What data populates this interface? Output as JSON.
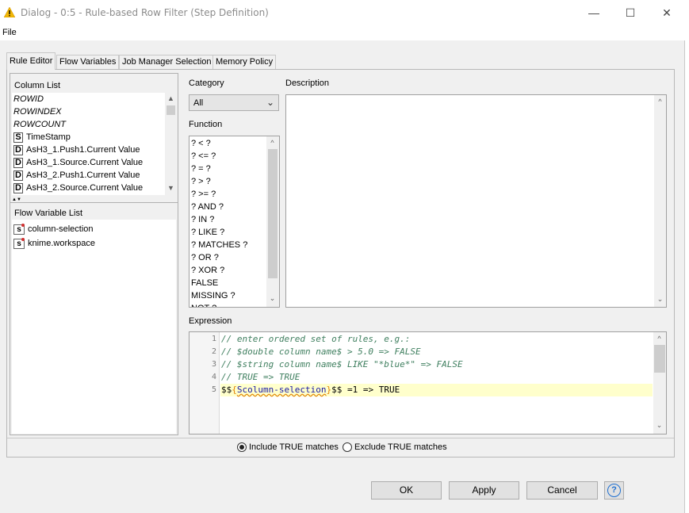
{
  "window": {
    "title": "Dialog - 0:5 - Rule-based Row Filter (Step Definition)",
    "minimize": "—",
    "maximize": "☐",
    "close": "✕"
  },
  "menu": {
    "file": "File"
  },
  "tabs": [
    {
      "label": "Rule Editor",
      "active": true
    },
    {
      "label": "Flow Variables"
    },
    {
      "label": "Job Manager Selection"
    },
    {
      "label": "Memory Policy"
    }
  ],
  "column_list": {
    "title": "Column List",
    "items": [
      {
        "label": "ROWID",
        "type": ""
      },
      {
        "label": "ROWINDEX",
        "type": ""
      },
      {
        "label": "ROWCOUNT",
        "type": ""
      },
      {
        "label": "TimeStamp",
        "type": "S"
      },
      {
        "label": "AsH3_1.Push1.Current Value",
        "type": "D"
      },
      {
        "label": "AsH3_1.Source.Current Value",
        "type": "D"
      },
      {
        "label": "AsH3_2.Push1.Current Value",
        "type": "D"
      },
      {
        "label": "AsH3_2.Source.Current Value",
        "type": "D"
      }
    ]
  },
  "flow_variable_list": {
    "title": "Flow Variable List",
    "items": [
      {
        "label": "column-selection",
        "type": "s"
      },
      {
        "label": "knime.workspace",
        "type": "s"
      }
    ]
  },
  "category": {
    "label": "Category",
    "value": "All"
  },
  "function": {
    "label": "Function",
    "items": [
      "? < ?",
      "? <= ?",
      "? = ?",
      "? > ?",
      "? >= ?",
      "? AND ?",
      "? IN ?",
      "? LIKE ?",
      "? MATCHES ?",
      "? OR ?",
      "? XOR ?",
      "FALSE",
      "MISSING ?",
      "NOT ?"
    ]
  },
  "description": {
    "label": "Description"
  },
  "expression": {
    "label": "Expression",
    "lines": [
      {
        "num": "1",
        "text": "// enter ordered set of rules, e.g.:"
      },
      {
        "num": "2",
        "text": "// $double column name$ > 5.0 => FALSE"
      },
      {
        "num": "3",
        "text": "// $string column name$ LIKE \"*blue*\" => FALSE"
      },
      {
        "num": "4",
        "text": "// TRUE => TRUE"
      },
      {
        "num": "5",
        "prefix": "$$",
        "brace_open": "{",
        "var": "Scolumn-selection",
        "brace_close": "}",
        "suffix": "$$ =1 => TRUE"
      }
    ]
  },
  "match_options": {
    "include": "Include TRUE matches",
    "exclude": "Exclude TRUE matches",
    "selected": "include"
  },
  "buttons": {
    "ok": "OK",
    "apply": "Apply",
    "cancel": "Cancel",
    "help": "?"
  },
  "colors": {
    "comment_green": "#3f7f5f",
    "highlight_line": "#ffffcc",
    "brace_orange": "#e08000",
    "var_blue": "#1a1aa6",
    "help_blue": "#1e6fd0"
  }
}
